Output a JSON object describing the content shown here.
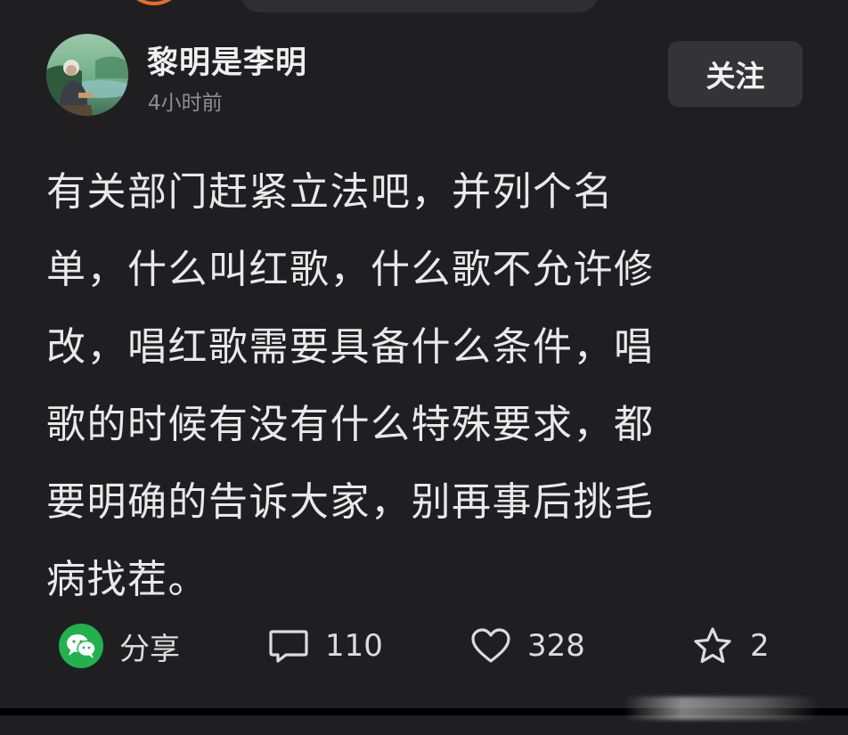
{
  "author": {
    "name": "黎明是李明",
    "time": "4小时前",
    "follow_label": "关注"
  },
  "post": {
    "lines": [
      "有关部门赶紧立法吧，并列个名",
      "单，什么叫红歌，什么歌不允许修",
      "改，唱红歌需要具备什么条件，唱",
      "歌的时候有没有什么特殊要求，都",
      "要明确的告诉大家，别再事后挑毛",
      "病找茬。"
    ]
  },
  "actions": {
    "share": {
      "label": "分享",
      "icon": "wechat-icon"
    },
    "comment": {
      "count": "110",
      "icon": "comment-icon"
    },
    "like": {
      "count": "328",
      "icon": "heart-icon"
    },
    "favorite": {
      "count": "2",
      "icon": "star-icon"
    }
  },
  "colors": {
    "background": "#1f1f21",
    "follow_button": "#343437",
    "wechat_green": "#22b14c"
  }
}
